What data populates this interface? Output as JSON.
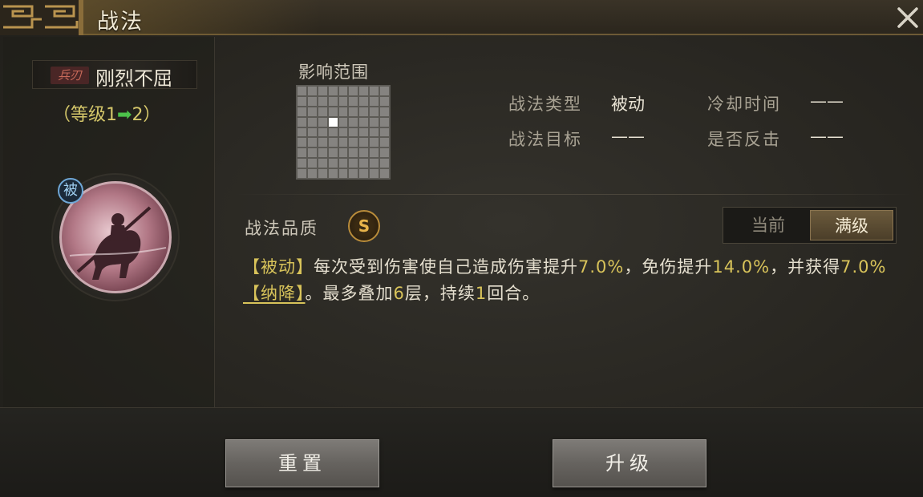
{
  "window": {
    "title": "战法",
    "close_icon": "close-icon"
  },
  "skill": {
    "type_badge": "兵刃",
    "name": "刚烈不屈",
    "level_prefix": "（等级1",
    "level_arrow": "➡",
    "level_suffix": "2）",
    "passive_badge": "被",
    "icon": "cavalry-general-icon"
  },
  "range": {
    "label": "影响范围",
    "grid_size": 9,
    "active_cell": [
      3,
      3
    ]
  },
  "info": {
    "type_label": "战法类型",
    "type_value": "被动",
    "cooldown_label": "冷却时间",
    "cooldown_value": "——",
    "target_label": "战法目标",
    "target_value": "——",
    "counter_label": "是否反击",
    "counter_value": "——"
  },
  "quality": {
    "label": "战法品质",
    "grade": "S"
  },
  "toggle": {
    "current": "当前",
    "max": "满级",
    "selected": "max"
  },
  "description": {
    "tag": "【被动】",
    "t1": "每次受到伤害使自己造成伤害提升",
    "v1": "7.0%",
    "t2": "，免伤提升",
    "v2": "14.0%",
    "t3": "，并获得",
    "v3": "7.0%",
    "link": "【纳降】",
    "t4": "。最多叠加",
    "v4": "6",
    "t5": "层，持续",
    "v5": "1",
    "t6": "回合。"
  },
  "buttons": {
    "reset": "重置",
    "upgrade": "升级"
  },
  "colors": {
    "highlight": "#d8c35a",
    "accent_gold": "#b98c3a",
    "arrow_green": "#4cc24a"
  }
}
